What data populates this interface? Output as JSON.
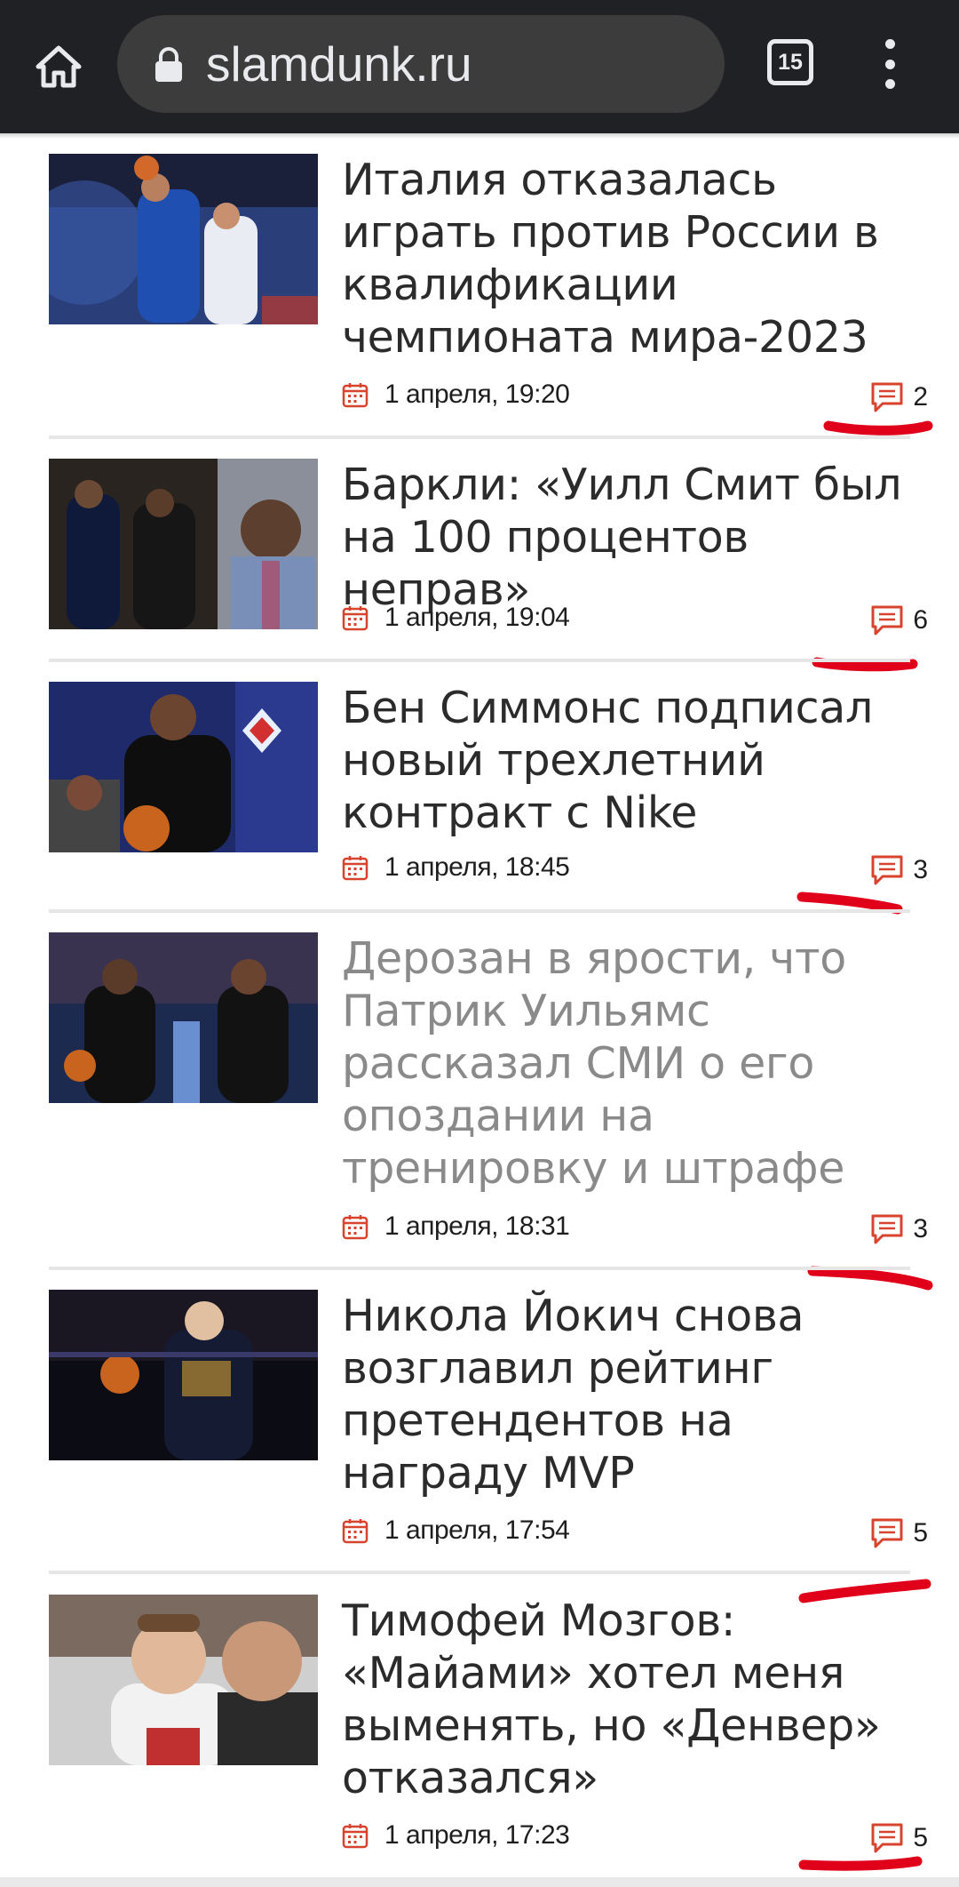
{
  "browser": {
    "url": "slamdunk.ru",
    "tab_count": "15",
    "icons": [
      "home-icon",
      "lock-icon",
      "tabs-icon",
      "more-vert-icon"
    ]
  },
  "colors": {
    "accent": "#d8432e",
    "title": "#2b2b2b",
    "visited_title": "#8a8a8a",
    "topbar": "#202124",
    "scribble": "#e0001a"
  },
  "articles": [
    {
      "title": "Италия отказалась играть против России в квалификации чемпионата мира-2023",
      "date": "1 апреля, 19:20",
      "comments": "2",
      "visited": false
    },
    {
      "title": "Баркли: «Уилл Смит был на 100 процентов неправ»",
      "date": "1 апреля, 19:04",
      "comments": "6",
      "visited": false
    },
    {
      "title": "Бен Симмонс подписал новый трехлетний контракт с Nike",
      "date": "1 апреля, 18:45",
      "comments": "3",
      "visited": false
    },
    {
      "title": "Дерозан в ярости, что Патрик Уильямс рассказал СМИ о его опоздании на тренировку и штрафе",
      "date": "1 апреля, 18:31",
      "comments": "3",
      "visited": true
    },
    {
      "title": "Никола Йокич снова возглавил рейтинг претендентов на награду MVP",
      "date": "1 апреля, 17:54",
      "comments": "5",
      "visited": false
    },
    {
      "title": "Тимофей Мозгов: «Майами» хотел меня выменять, но «Денвер» отказался»",
      "date": "1 апреля, 17:23",
      "comments": "5",
      "visited": false
    }
  ]
}
